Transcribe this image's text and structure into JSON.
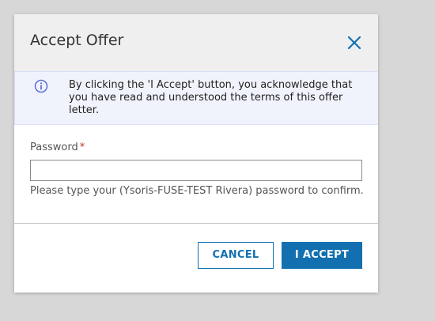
{
  "dialog": {
    "title": "Accept Offer",
    "close_icon": "close-icon",
    "info": {
      "icon": "info-icon",
      "message": "By clicking the 'I Accept' button, you acknowledge that you have read and understood the terms of this offer letter."
    },
    "password": {
      "label": "Password",
      "required_mark": "*",
      "value": "",
      "hint": "Please type your (Ysoris-FUSE-TEST Rivera) password to confirm."
    },
    "buttons": {
      "cancel_label": "CANCEL",
      "accept_label": "I ACCEPT"
    }
  },
  "colors": {
    "accent": "#1270b0",
    "required": "#c0392b",
    "banner_bg": "#f1f3fc",
    "overlay_bg": "#d7d7d7"
  }
}
